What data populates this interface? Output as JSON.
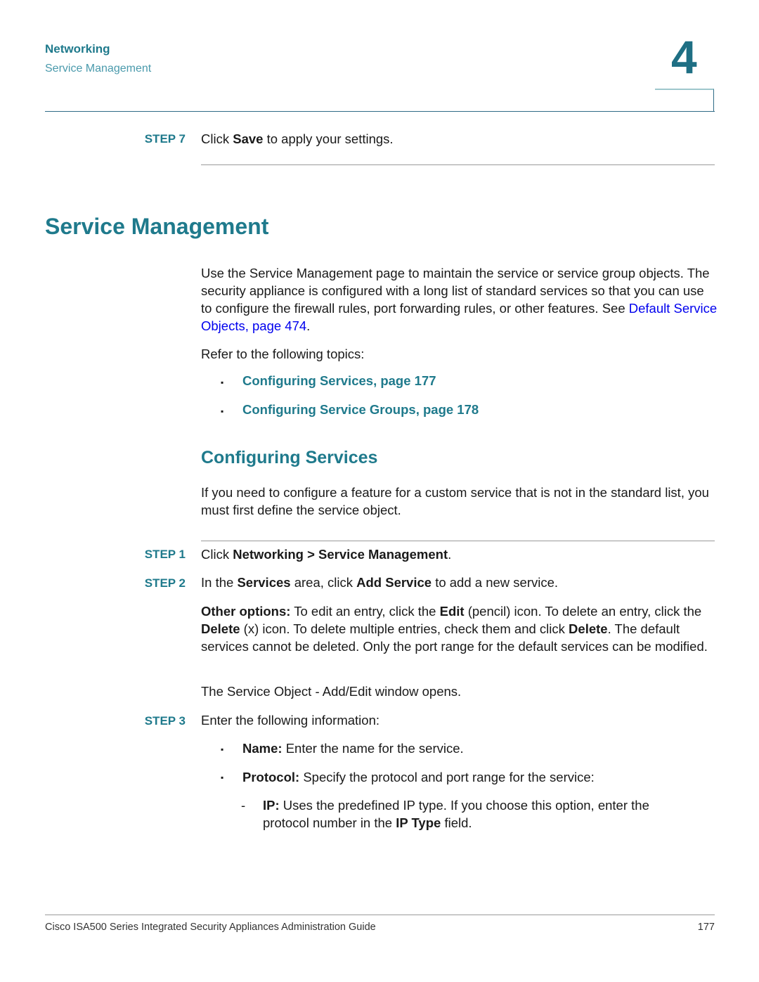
{
  "header": {
    "section": "Networking",
    "subsection": "Service Management",
    "chapter_number": "4"
  },
  "step7": {
    "label": "STEP 7",
    "pre": "Click ",
    "bold": "Save",
    "post": " to apply your settings."
  },
  "main": {
    "title": "Service Management",
    "intro_text": "Use the Service Management page to maintain the service or service group objects. The security appliance is configured with a long list of standard services so that you can use to configure the firewall rules, port forwarding rules, or other features. See ",
    "intro_link": "Default Service Objects, page 474",
    "intro_end": ".",
    "refer_text": "Refer to the following topics:",
    "topics": [
      {
        "label": "Configuring Services, page 177"
      },
      {
        "label": "Configuring Service Groups, page 178"
      }
    ],
    "bullet_glyph": "▪"
  },
  "configuring": {
    "title": "Configuring Services",
    "intro": "If you need to configure a feature for a custom service that is not in the standard list, you must first define the service object.",
    "step1": {
      "label": "STEP 1",
      "pre": "Click ",
      "bold": "Networking > Service Management",
      "post": "."
    },
    "step2": {
      "label": "STEP 2",
      "t1": "In the ",
      "b1": "Services",
      "t2": " area, click ",
      "b2": "Add Service",
      "t3": " to add a new service."
    },
    "other_options": {
      "b1": "Other options:",
      "t1": " To edit an entry, click the ",
      "b2": "Edit",
      "t2": " (pencil) icon. To delete an entry, click the ",
      "b3": "Delete",
      "t3": " (x) icon. To delete multiple entries, check them and click ",
      "b4": "Delete",
      "t4": ". The default services cannot be deleted. Only the port range for the default services can be modified."
    },
    "window_opens": "The Service Object - Add/Edit window opens.",
    "step3": {
      "label": "STEP 3",
      "text": "Enter the following information:"
    },
    "fields": [
      {
        "bold": "Name:",
        "text": " Enter the name for the service."
      },
      {
        "bold": "Protocol:",
        "text": " Specify the protocol and port range for the service:"
      }
    ],
    "sub_item": {
      "dash": "-",
      "b1": "IP:",
      "t1": " Uses the predefined IP type. If you choose this option, enter the protocol number in the ",
      "b2": "IP Type",
      "t2": " field."
    }
  },
  "footer": {
    "title": "Cisco ISA500 Series Integrated Security Appliances Administration Guide",
    "page": "177"
  }
}
